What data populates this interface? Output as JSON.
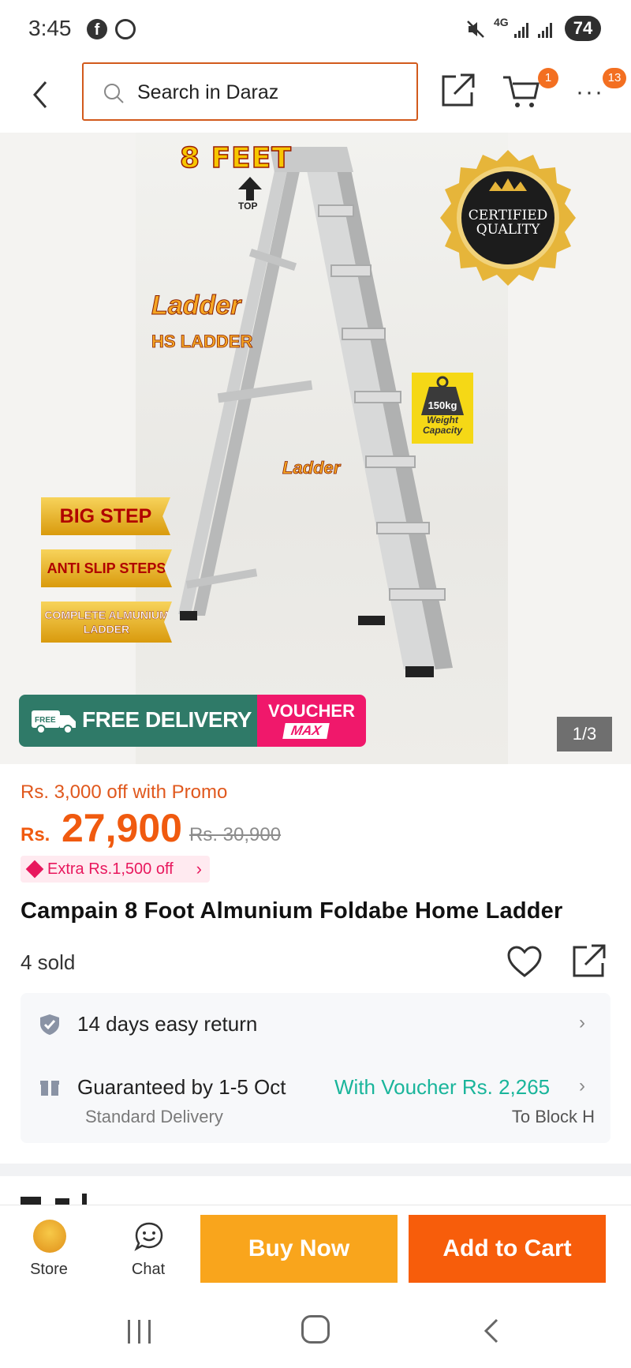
{
  "status_bar": {
    "time": "3:45",
    "network": "4G",
    "battery": "74"
  },
  "header": {
    "search_placeholder": "Search in Daraz",
    "cart_count": "1",
    "more_count": "13"
  },
  "gallery": {
    "feet_label": "8 FEET",
    "top_label": "TOP",
    "seal_text": "CERTIFIED QUALITY",
    "brand_logo": "Ladder",
    "brand_name": "HS LADDER",
    "weight_value": "150kg",
    "weight_label": "Weight Capacity",
    "ladder_logo": "Ladder",
    "ribbon_1": "BIG STEP",
    "ribbon_2": "ANTI SLIP STEPS",
    "ribbon_3": "COMPLETE ALMUNIUM LADDER",
    "free_badge": "FREE",
    "delivery_text": "FREE DELIVERY",
    "voucher_text": "VOUCHER",
    "voucher_max": "MAX",
    "page_indicator": "1/3"
  },
  "product": {
    "promo": "Rs. 3,000 off with Promo",
    "currency": "Rs.",
    "price": "27,900",
    "old_price": "Rs. 30,900",
    "extra_discount": "Extra Rs.1,500 off",
    "title": "Campain 8 Foot Almunium Foldabe Home Ladder",
    "sold": "4 sold"
  },
  "service": {
    "return_text": "14 days easy return",
    "guarantee_text": "Guaranteed by 1-5 Oct",
    "voucher_text": "With Voucher Rs. 2,265",
    "delivery_type": "Standard Delivery",
    "location": "To Block H"
  },
  "bottom_bar": {
    "store_label": "Store",
    "chat_label": "Chat",
    "buy_now": "Buy Now",
    "add_to_cart": "Add to Cart"
  },
  "colors": {
    "brand_orange": "#f75d0b",
    "buy_now_yellow": "#f9a51c",
    "voucher_teal": "#1ab59b",
    "promo_pink": "#e8175d"
  }
}
